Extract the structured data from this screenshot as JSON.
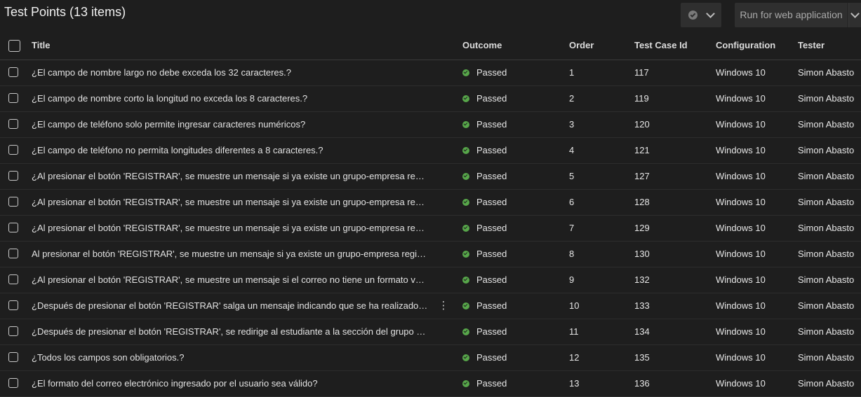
{
  "header": {
    "title": "Test Points (13 items)",
    "outcome_filter_icon": "check-circle-icon",
    "run_button_label": "Run for web application"
  },
  "columns": {
    "title": "Title",
    "outcome": "Outcome",
    "order": "Order",
    "test_case_id": "Test Case Id",
    "configuration": "Configuration",
    "tester": "Tester"
  },
  "colors": {
    "background": "#1e1e1e",
    "passed": "#57a64a",
    "button_bg": "#2f2f2f"
  },
  "rows": [
    {
      "title": "¿El campo de nombre largo no debe exceda los 32 caracteres.?",
      "outcome": "Passed",
      "order": "1",
      "test_case_id": "117",
      "configuration": "Windows 10",
      "tester": "Simon Abasto"
    },
    {
      "title": "¿El campo de nombre corto la longitud no exceda los 8 caracteres.?",
      "outcome": "Passed",
      "order": "2",
      "test_case_id": "119",
      "configuration": "Windows 10",
      "tester": "Simon Abasto"
    },
    {
      "title": "¿El campo de teléfono solo permite ingresar caracteres numéricos?",
      "outcome": "Passed",
      "order": "3",
      "test_case_id": "120",
      "configuration": "Windows 10",
      "tester": "Simon Abasto"
    },
    {
      "title": "¿El campo de teléfono no permita longitudes diferentes a 8 caracteres.?",
      "outcome": "Passed",
      "order": "4",
      "test_case_id": "121",
      "configuration": "Windows 10",
      "tester": "Simon Abasto"
    },
    {
      "title": "¿Al presionar el botón 'REGISTRAR', se muestre un mensaje si ya existe un grupo-empresa regist...",
      "outcome": "Passed",
      "order": "5",
      "test_case_id": "127",
      "configuration": "Windows 10",
      "tester": "Simon Abasto"
    },
    {
      "title": "¿Al presionar el botón 'REGISTRAR', se muestre un mensaje si ya existe un grupo-empresa regist...",
      "outcome": "Passed",
      "order": "6",
      "test_case_id": "128",
      "configuration": "Windows 10",
      "tester": "Simon Abasto"
    },
    {
      "title": "¿Al presionar el botón 'REGISTRAR', se muestre un mensaje si ya existe un grupo-empresa regist...",
      "outcome": "Passed",
      "order": "7",
      "test_case_id": "129",
      "configuration": "Windows 10",
      "tester": "Simon Abasto"
    },
    {
      "title": "Al presionar el botón 'REGISTRAR', se muestre un mensaje si ya existe un grupo-empresa registr...",
      "outcome": "Passed",
      "order": "8",
      "test_case_id": "130",
      "configuration": "Windows 10",
      "tester": "Simon Abasto"
    },
    {
      "title": "¿Al presionar el botón 'REGISTRAR', se muestre un mensaje si el correo no tiene un formato váli...",
      "outcome": "Passed",
      "order": "9",
      "test_case_id": "132",
      "configuration": "Windows 10",
      "tester": "Simon Abasto"
    },
    {
      "title": "¿Después de presionar el botón 'REGISTRAR' salga un mensaje indicando que se ha realizado el ...",
      "outcome": "Passed",
      "order": "10",
      "test_case_id": "133",
      "configuration": "Windows 10",
      "tester": "Simon Abasto",
      "more_icon": "⋮"
    },
    {
      "title": "¿Después de presionar el botón 'REGISTRAR', se redirige al estudiante a la sección del grupo de ...",
      "outcome": "Passed",
      "order": "11",
      "test_case_id": "134",
      "configuration": "Windows 10",
      "tester": "Simon Abasto"
    },
    {
      "title": "¿Todos los campos son obligatorios.?",
      "outcome": "Passed",
      "order": "12",
      "test_case_id": "135",
      "configuration": "Windows 10",
      "tester": "Simon Abasto"
    },
    {
      "title": "¿El formato del correo electrónico ingresado por el usuario sea válido?",
      "outcome": "Passed",
      "order": "13",
      "test_case_id": "136",
      "configuration": "Windows 10",
      "tester": "Simon Abasto"
    }
  ]
}
